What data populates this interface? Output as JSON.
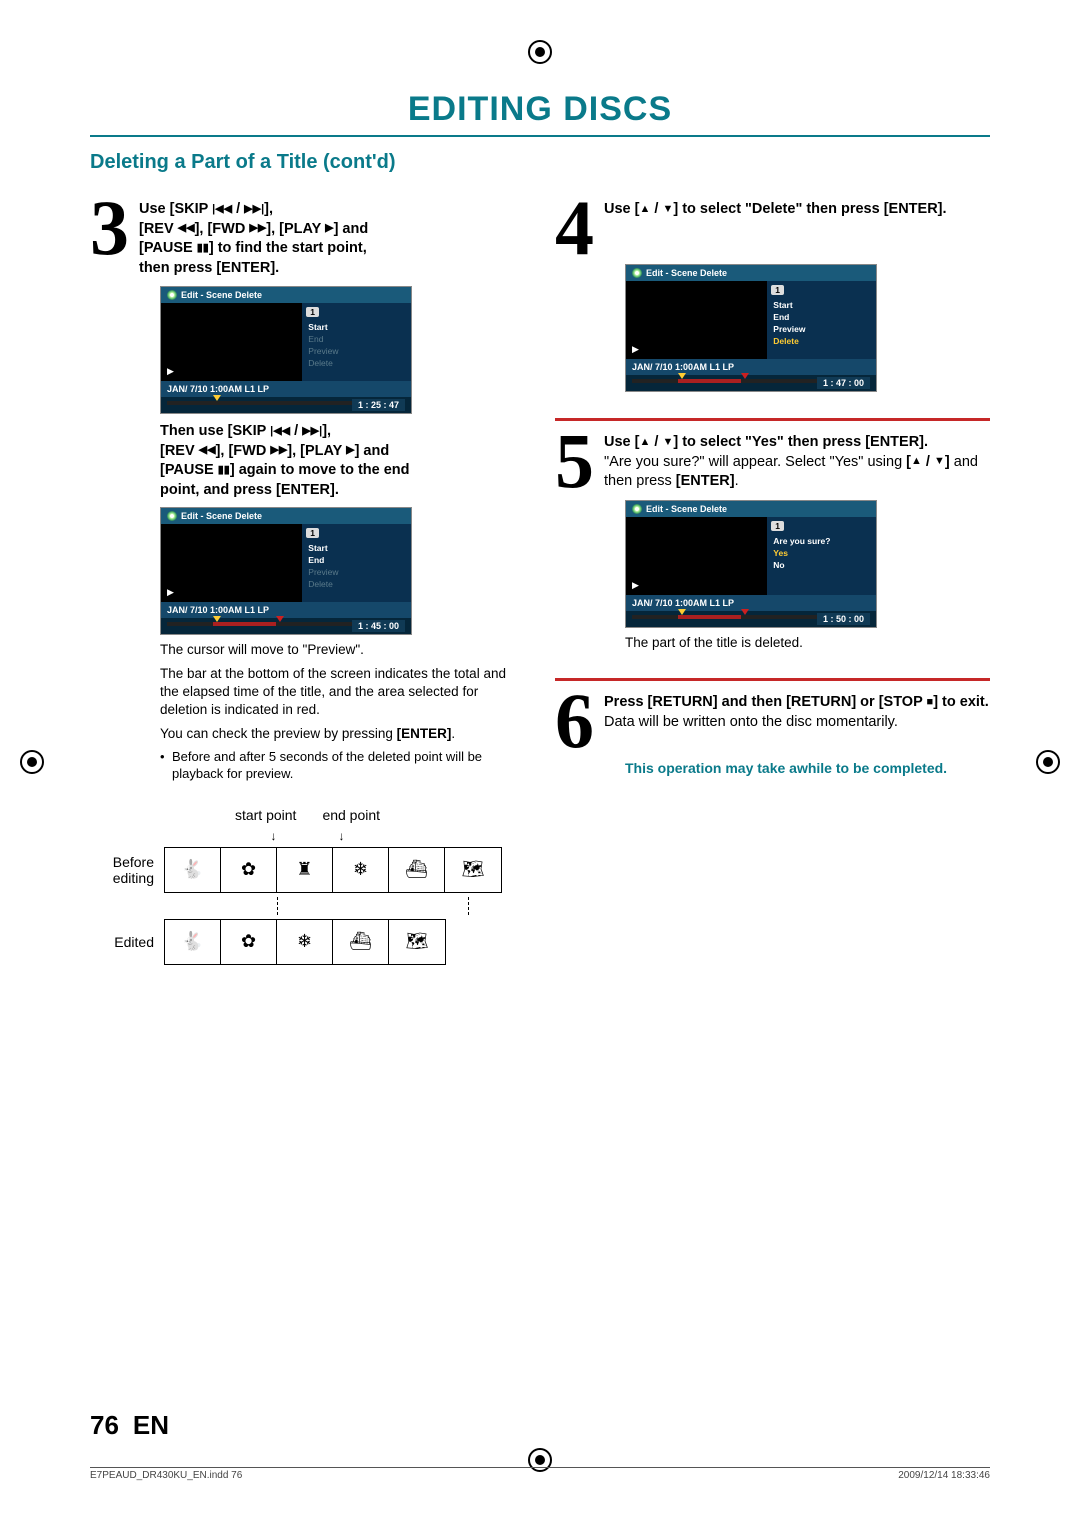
{
  "title": "EDITING DISCS",
  "section": "Deleting a Part of a Title (cont'd)",
  "step3": {
    "num": "3",
    "line1_a": "Use [SKIP ",
    "line1_b": " / ",
    "line1_c": "],",
    "line2_a": "[REV ",
    "line2_b": "], [FWD ",
    "line2_c": "], [PLAY ",
    "line2_d": "] and",
    "line3_a": "[PAUSE ",
    "line3_b": "] to find the start point,",
    "line4": "then press [ENTER].",
    "osd1": {
      "title": "Edit - Scene Delete",
      "chip": "1",
      "menu": [
        "Start",
        "End",
        "Preview",
        "Delete"
      ],
      "menu_states": [
        "sel",
        "dim",
        "dim",
        "dim"
      ],
      "footer": "JAN/ 7/10 1:00AM L1   LP",
      "time": "1 : 25 : 47"
    },
    "mid_a": "Then use [SKIP ",
    "mid_b": " / ",
    "mid_c": "],",
    "mid2_a": "[REV ",
    "mid2_b": "],  [FWD ",
    "mid2_c": "], [PLAY ",
    "mid2_d": "] and",
    "mid3_a": "[PAUSE ",
    "mid3_b": "] again to move to the end",
    "mid4": "point, and press [ENTER].",
    "osd2": {
      "title": "Edit - Scene Delete",
      "chip": "1",
      "menu": [
        "Start",
        "End",
        "Preview",
        "Delete"
      ],
      "menu_states": [
        "sel",
        "sel",
        "dim",
        "dim"
      ],
      "footer": "JAN/ 7/10 1:00AM L1   LP",
      "time": "1 : 45 : 00"
    },
    "p1": "The cursor will move to \"Preview\".",
    "p2": "The bar at the bottom of the screen indicates the total and the elapsed time of the title, and the area selected for deletion is indicated in red.",
    "p3_a": "You can check the preview by pressing ",
    "p3_b": "[ENTER]",
    "p3_c": ".",
    "b1": "Before and after 5 seconds of the deleted point will be playback for preview."
  },
  "timeline": {
    "start": "start point",
    "end": "end point",
    "before": "Before editing",
    "edited": "Edited"
  },
  "step4": {
    "num": "4",
    "t_a": "Use [",
    "t_b": " / ",
    "t_c": "] to select \"Delete\" then press [ENTER].",
    "osd": {
      "title": "Edit - Scene Delete",
      "chip": "1",
      "menu": [
        "Start",
        "End",
        "Preview",
        "Delete"
      ],
      "menu_states": [
        "sel",
        "sel",
        "sel",
        "hilite"
      ],
      "footer": "JAN/ 7/10 1:00AM L1   LP",
      "time": "1 : 47 : 00"
    }
  },
  "step5": {
    "num": "5",
    "t_a": "Use [",
    "t_b": " / ",
    "t_c": "] to select \"Yes\" then press [ENTER].",
    "p_a": "\"Are you sure?\" will appear. Select \"Yes\" using ",
    "p_b": "[",
    "p_c": " / ",
    "p_d": "]",
    "p_e": " and then press ",
    "p_f": "[ENTER]",
    "p_g": ".",
    "osd": {
      "title": "Edit - Scene Delete",
      "chip": "1",
      "menu": [
        "Are you sure?",
        "Yes",
        "No"
      ],
      "footer": "JAN/ 7/10 1:00AM L1   LP",
      "time": "1 : 50 : 00"
    },
    "after": "The part of the title is deleted."
  },
  "step6": {
    "num": "6",
    "t_a": "Press [RETURN] and then [RETURN] or [STOP ",
    "t_b": "] to exit.",
    "p": "Data will be written onto the disc momentarily.",
    "note": "This operation may take awhile to be completed."
  },
  "footer": {
    "page": "76",
    "lang": "EN"
  },
  "printline": {
    "left": "E7PEAUD_DR430KU_EN.indd   76",
    "right": "2009/12/14   18:33:46"
  }
}
